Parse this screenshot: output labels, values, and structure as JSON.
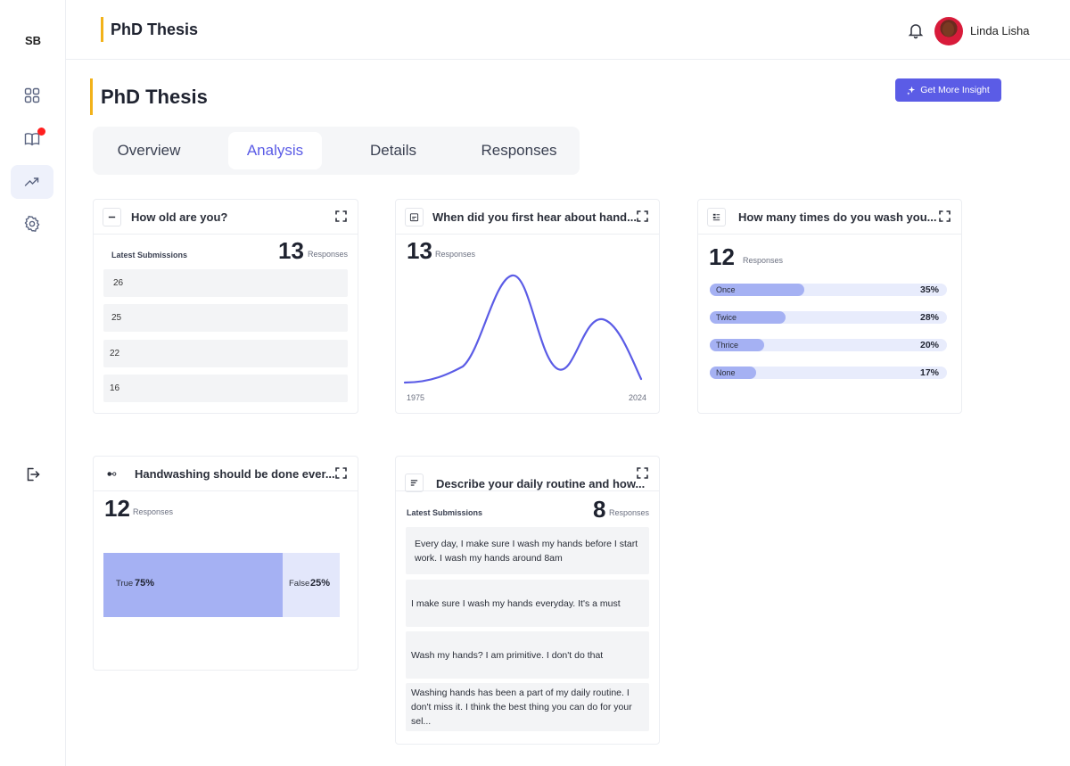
{
  "sidebar": {
    "logo": "SB",
    "items": [
      {
        "icon": "grid-icon"
      },
      {
        "icon": "book-icon",
        "badge": true
      },
      {
        "icon": "trend-icon",
        "active": true
      },
      {
        "icon": "gear-icon"
      }
    ],
    "logout_icon": "logout-icon"
  },
  "topbar": {
    "title": "PhD Thesis",
    "user_name": "Linda Lisha"
  },
  "page": {
    "title": "PhD Thesis",
    "insight_button": "Get More Insight"
  },
  "tabs": [
    {
      "label": "Overview",
      "active": false
    },
    {
      "label": "Analysis",
      "active": true
    },
    {
      "label": "Details",
      "active": false
    },
    {
      "label": "Responses",
      "active": false
    }
  ],
  "cards": {
    "age": {
      "question": "How old are you?",
      "latest_label": "Latest Submissions",
      "count": "13",
      "responses_label": "Responses",
      "submissions": [
        "26",
        "25",
        "22",
        "16"
      ]
    },
    "first_hear": {
      "question": "When did you first hear about hand...",
      "count": "13",
      "responses_label": "Responses",
      "x_start": "1975",
      "x_end": "2024"
    },
    "times_wash": {
      "question": "How many times do you wash you...",
      "count": "12",
      "responses_label": "Responses",
      "options": [
        {
          "label": "Once",
          "pct": "35%",
          "value": 35
        },
        {
          "label": "Twice",
          "pct": "28%",
          "value": 28
        },
        {
          "label": "Thrice",
          "pct": "20%",
          "value": 20
        },
        {
          "label": "None",
          "pct": "17%",
          "value": 17
        }
      ]
    },
    "everyday": {
      "question": "Handwashing should be done ever...",
      "count": "12",
      "responses_label": "Responses",
      "true_label": "True",
      "true_pct": "75%",
      "false_label": "False",
      "false_pct": "25%"
    },
    "routine": {
      "question": "Describe your daily routine and how...",
      "latest_label": "Latest Submissions",
      "count": "8",
      "responses_label": "Responses",
      "submissions": [
        "Every day, I make sure I wash my hands before I start work. I wash my hands around 8am",
        "I make sure I wash my hands everyday. It's a must",
        "Wash my hands? I am primitive. I don't do that",
        "Washing hands has been a part of my daily routine. I don't miss it. I think the best thing you can do for your sel..."
      ]
    }
  },
  "colors": {
    "accent": "#5b5ce6",
    "title_bar": "#f2b21a",
    "bar_fill": "#a5b1f3",
    "bar_track": "#e8ecfc",
    "badge": "#ff1f1f"
  }
}
